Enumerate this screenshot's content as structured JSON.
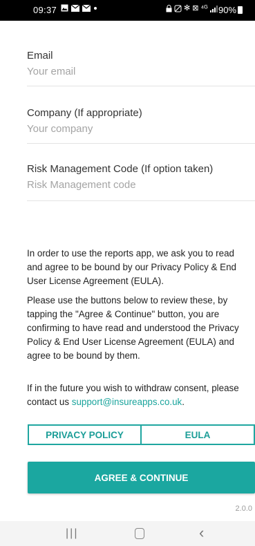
{
  "status_bar": {
    "time": "09:37",
    "battery": "90%",
    "icons": [
      "image-icon",
      "mail-icon",
      "mail-icon",
      "dot-icon",
      "lock-icon",
      "mute-icon",
      "bluetooth-icon",
      "vibrate-icon",
      "4g-icon",
      "signal-icon"
    ]
  },
  "form": {
    "email": {
      "label": "Email",
      "placeholder": "Your email",
      "value": ""
    },
    "company": {
      "label": "Company (If appropriate)",
      "placeholder": "Your company",
      "value": ""
    },
    "risk_code": {
      "label": "Risk Management Code (If option taken)",
      "placeholder": "Risk Management code",
      "value": ""
    }
  },
  "consent": {
    "para1": "In order to use the reports app, we ask you to read and agree to be bound by our Privacy Policy & End User License Agreement (EULA).",
    "para2": "Please use the buttons below to review these, by tapping the \"Agree & Continue\" button, you are confirming to have read and understood the Privacy Policy & End User License Agreement (EULA) and agree to be bound by them.",
    "para3_prefix": "If in the future you wish to withdraw consent, please contact us ",
    "support_email": "support@insureapps.co.uk",
    "para3_suffix": "."
  },
  "buttons": {
    "privacy_policy": "PRIVACY POLICY",
    "eula": "EULA",
    "agree_continue": "AGREE & CONTINUE"
  },
  "version": "2.0.0",
  "colors": {
    "accent": "#1ba7a0",
    "link": "#1aa49c"
  }
}
